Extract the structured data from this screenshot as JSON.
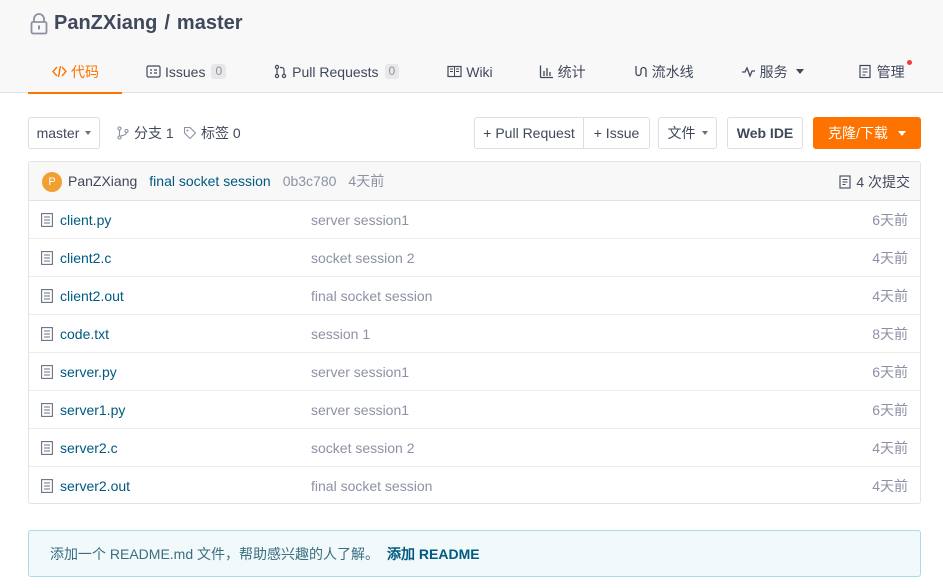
{
  "repo": {
    "owner": "PanZXiang",
    "separator": "/",
    "name": "master"
  },
  "tabs": [
    {
      "label": "代码",
      "active": true
    },
    {
      "label": "Issues",
      "badge": "0"
    },
    {
      "label": "Pull Requests",
      "badge": "0"
    },
    {
      "label": "Wiki"
    },
    {
      "label": "统计"
    },
    {
      "label": "流水线"
    },
    {
      "label": "服务"
    },
    {
      "label": "管理"
    }
  ],
  "toolbar": {
    "branch_select": "master",
    "branches_label": "分支 1",
    "tags_label": "标签 0",
    "pull_request_button": "+ Pull Request",
    "issue_button": "+ Issue",
    "file_button": "文件",
    "web_ide_button": "Web IDE",
    "clone_button": "克隆/下载"
  },
  "latest_commit": {
    "avatar_letter": "P",
    "author": "PanZXiang",
    "message": "final socket session",
    "sha": "0b3c780",
    "time": "4天前",
    "count_label": "4 次提交"
  },
  "files": [
    {
      "name": "client.py",
      "message": "server session1",
      "time": "6天前"
    },
    {
      "name": "client2.c",
      "message": "socket session 2",
      "time": "4天前"
    },
    {
      "name": "client2.out",
      "message": "final socket session",
      "time": "4天前"
    },
    {
      "name": "code.txt",
      "message": "session 1",
      "time": "8天前"
    },
    {
      "name": "server.py",
      "message": "server session1",
      "time": "6天前"
    },
    {
      "name": "server1.py",
      "message": "server session1",
      "time": "6天前"
    },
    {
      "name": "server2.c",
      "message": "socket session 2",
      "time": "4天前"
    },
    {
      "name": "server2.out",
      "message": "final socket session",
      "time": "4天前"
    }
  ],
  "readme_notice": {
    "text": "添加一个 README.md 文件，帮助感兴趣的人了解。",
    "link": "添加 README"
  },
  "colors": {
    "accent": "#fe7300",
    "link": "#005980",
    "muted": "#8c92a4"
  }
}
